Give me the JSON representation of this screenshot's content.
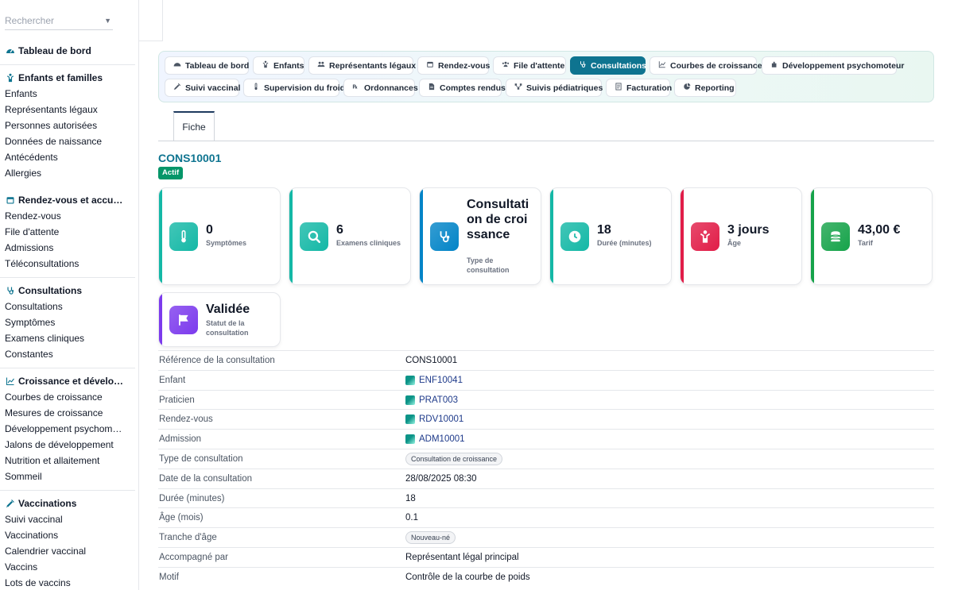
{
  "sidebar": {
    "search_placeholder": "Rechercher",
    "dashboard": "Tableau de bord",
    "sections": [
      {
        "title": "Enfants et familles",
        "icon": "child-icon",
        "items": [
          "Enfants",
          "Représentants légaux",
          "Personnes autorisées",
          "Données de naissance",
          "Antécédents",
          "Allergies"
        ]
      },
      {
        "title": "Rendez-vous et accu…",
        "icon": "calendar-icon",
        "items": [
          "Rendez-vous",
          "File d'attente",
          "Admissions",
          "Téléconsultations"
        ]
      },
      {
        "title": "Consultations",
        "icon": "stethoscope-icon",
        "items": [
          "Consultations",
          "Symptômes",
          "Examens cliniques",
          "Constantes"
        ]
      },
      {
        "title": "Croissance et dévelo…",
        "icon": "chart-line-icon",
        "items": [
          "Courbes de croissance",
          "Mesures de croissance",
          "Développement psychom…",
          "Jalons de développement",
          "Nutrition et allaitement",
          "Sommeil"
        ]
      },
      {
        "title": "Vaccinations",
        "icon": "syringe-icon",
        "items": [
          "Suivi vaccinal",
          "Vaccinations",
          "Calendrier vaccinal",
          "Vaccins",
          "Lots de vaccins"
        ]
      }
    ]
  },
  "nav": {
    "row1": [
      {
        "label": "Tableau de bord",
        "icon": "gauge-icon"
      },
      {
        "label": "Enfants",
        "icon": "child-icon"
      },
      {
        "label": "Représentants légaux",
        "icon": "users-icon"
      },
      {
        "label": "Rendez-vous",
        "icon": "calendar-icon"
      },
      {
        "label": "File d'attente",
        "icon": "people-icon"
      },
      {
        "label": "Consultations",
        "icon": "stethoscope-icon",
        "active": true
      },
      {
        "label": "Courbes de croissance",
        "icon": "chart-line-icon"
      },
      {
        "label": "Développement psychomoteur",
        "icon": "puzzle-icon"
      }
    ],
    "row2": [
      {
        "label": "Suivi vaccinal",
        "icon": "syringe-icon"
      },
      {
        "label": "Supervision du froid",
        "icon": "thermometer-icon"
      },
      {
        "label": "Ordonnances",
        "icon": "prescription-icon"
      },
      {
        "label": "Comptes rendus",
        "icon": "file-icon"
      },
      {
        "label": "Suivis pédiatriques",
        "icon": "network-icon"
      },
      {
        "label": "Facturation",
        "icon": "invoice-icon"
      },
      {
        "label": "Reporting",
        "icon": "pie-chart-icon"
      }
    ]
  },
  "tab": {
    "label": "Fiche"
  },
  "record": {
    "title": "CONS10001",
    "status": "Actif"
  },
  "cards": [
    {
      "value": "0",
      "label": "Symptômes",
      "icon": "thermometer-icon",
      "color": "#14b8a6"
    },
    {
      "value": "6",
      "label": "Examens cliniques",
      "icon": "search-icon",
      "color": "#14b8a6"
    },
    {
      "value": "Consultation de croissance",
      "label": "Type de consultation",
      "icon": "stethoscope-icon",
      "color": "#0284c7"
    },
    {
      "value": "18",
      "label": "Durée (minutes)",
      "icon": "clock-icon",
      "color": "#14b8a6"
    },
    {
      "value": "3 jours",
      "label": "Âge",
      "icon": "child-icon",
      "color": "#e11d48"
    },
    {
      "value": "43,00 €",
      "label": "Tarif",
      "icon": "coins-icon",
      "color": "#16a34a"
    },
    {
      "value": "Validée",
      "label": "Statut de la consultation",
      "icon": "flag-icon",
      "color": "#7c3aed"
    }
  ],
  "details": [
    {
      "key": "Référence de la consultation",
      "value": "CONS10001",
      "kind": "text"
    },
    {
      "key": "Enfant",
      "value": "ENF10041",
      "kind": "link"
    },
    {
      "key": "Praticien",
      "value": "PRAT003",
      "kind": "link"
    },
    {
      "key": "Rendez-vous",
      "value": "RDV10001",
      "kind": "link"
    },
    {
      "key": "Admission",
      "value": "ADM10001",
      "kind": "link"
    },
    {
      "key": "Type de consultation",
      "value": "Consultation de croissance",
      "kind": "pill"
    },
    {
      "key": "Date de la consultation",
      "value": "28/08/2025 08:30",
      "kind": "text"
    },
    {
      "key": "Durée (minutes)",
      "value": "18",
      "kind": "text"
    },
    {
      "key": "Âge (mois)",
      "value": "0.1",
      "kind": "text"
    },
    {
      "key": "Tranche d'âge",
      "value": "Nouveau-né",
      "kind": "pill"
    },
    {
      "key": "Accompagné par",
      "value": "Représentant légal principal",
      "kind": "text"
    },
    {
      "key": "Motif",
      "value": "Contrôle de la courbe de poids",
      "kind": "text"
    }
  ]
}
